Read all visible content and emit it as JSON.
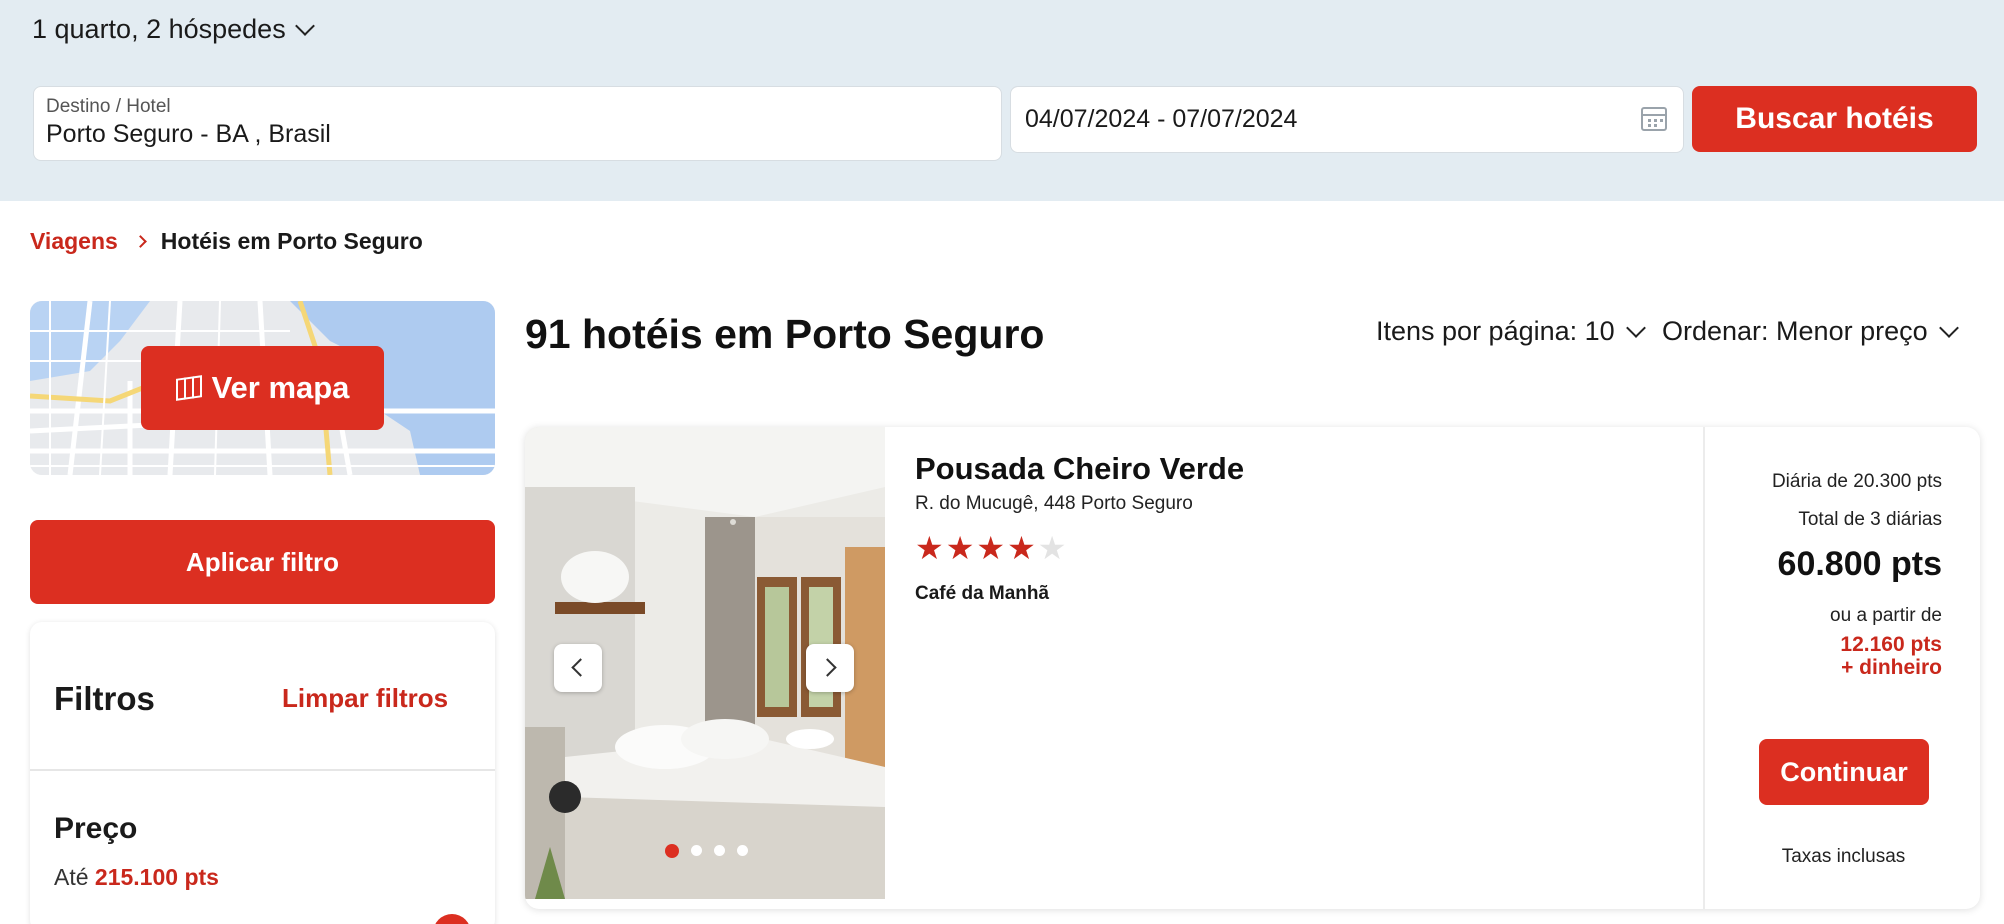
{
  "search": {
    "guests_label": "1 quarto, 2 hóspedes",
    "destination_label": "Destino / Hotel",
    "destination_value": "Porto Seguro - BA , Brasil",
    "dates_value": "04/07/2024 - 07/07/2024",
    "search_button": "Buscar hotéis"
  },
  "breadcrumb": {
    "root": "Viagens",
    "current": "Hotéis em Porto Seguro"
  },
  "sidebar": {
    "map_button": "Ver mapa",
    "apply_button": "Aplicar filtro",
    "filters_title": "Filtros",
    "clear_filters": "Limpar filtros",
    "price_title": "Preço",
    "price_upto_prefix": "Até",
    "price_upto_value": "215.100 pts"
  },
  "results": {
    "title": "91 hotéis em Porto Seguro",
    "per_page_label": "Itens por página: 10",
    "sort_label": "Ordenar: Menor preço"
  },
  "hotel": {
    "name": "Pousada Cheiro Verde",
    "address": "R. do Mucugê, 448 Porto Seguro",
    "rating": 4,
    "max_rating": 5,
    "amenity": "Café da Manhã",
    "photo_count": 4,
    "active_photo": 1,
    "daily_rate": "Diária de 20.300 pts",
    "total_nights": "Total de 3 diárias",
    "total_points": "60.800 pts",
    "or_from": "ou a partir de",
    "mixed_points": "12.160 pts",
    "mixed_cash": "+ dinheiro",
    "continue_button": "Continuar",
    "taxes_note": "Taxas inclusas"
  },
  "colors": {
    "accent": "#dc2f21",
    "search_bg": "#e3ecf2",
    "star_empty": "#e3e3e3"
  }
}
